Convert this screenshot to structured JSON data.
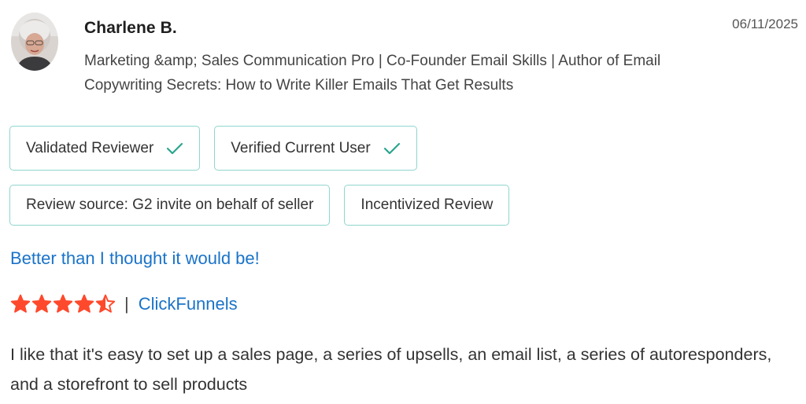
{
  "review": {
    "author_name": "Charlene B.",
    "date": "06/11/2025",
    "author_headline": "Marketing &amp; Sales Communication Pro | Co-Founder Email Skills | Author of Email Copywriting Secrets: How to Write Killer Emails That Get Results",
    "badges_row1": [
      {
        "label": "Validated Reviewer",
        "icon": "check-icon"
      },
      {
        "label": "Verified Current User",
        "icon": "check-icon"
      }
    ],
    "badges_row2": [
      {
        "label": "Review source: G2 invite on behalf of seller"
      },
      {
        "label": "Incentivized Review"
      }
    ],
    "title": "Better than I thought it would be!",
    "rating": 4.5,
    "rating_max": 5,
    "separator": "|",
    "product": "ClickFunnels",
    "body": "I like that it's easy to set up a sales page, a series of upsells, an email list, a series of autoresponders, and a storefront to sell products"
  },
  "colors": {
    "accent_link": "#1a73c8",
    "badge_border": "#8fd6cf",
    "check": "#2aa58f",
    "star": "#ff492c"
  }
}
